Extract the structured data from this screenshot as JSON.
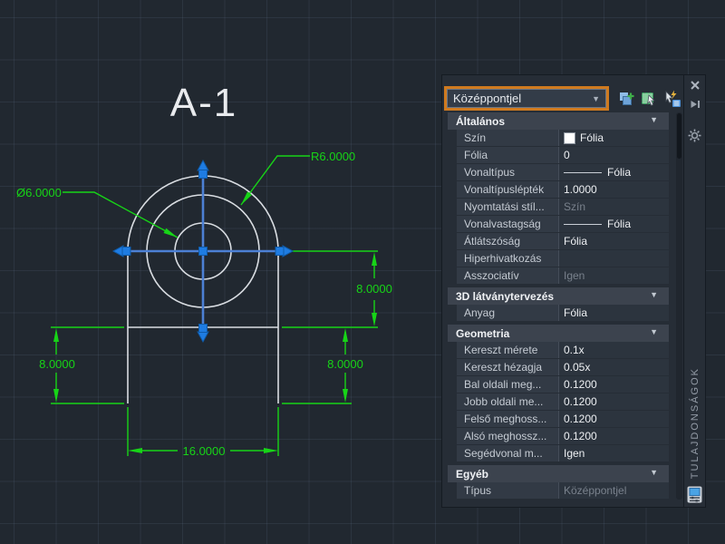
{
  "drawing": {
    "view_label": "A-1",
    "dims": {
      "radius": "R6.0000",
      "diameter": "Ø6.0000",
      "vert_right_top": "8.0000",
      "vert_right_bottom": "8.0000",
      "vert_left": "8.0000",
      "horiz_bottom": "16.0000"
    },
    "colors": {
      "canvas_background": "#212830",
      "dimension_green": "#17d417",
      "geometry_white": "#d9dde2",
      "selection_blue": "#4c80d4",
      "grip_blue": "#1e7ce2"
    }
  },
  "palette": {
    "title": "TULAJDONSÁGOK",
    "selector": {
      "value": "Középpontjel"
    },
    "accent_border": "#cf7a1f",
    "toolbar_icons": [
      "toggle-pickadd",
      "select-objects",
      "quick-select"
    ],
    "titlebar_icons": [
      "close",
      "auto-hide",
      "settings",
      "palette-properties"
    ],
    "sections": [
      {
        "title": "Általános",
        "rows": [
          {
            "label": "Szín",
            "value": "Fólia"
          },
          {
            "label": "Fólia",
            "value": "0"
          },
          {
            "label": "Vonaltípus",
            "value": "Fólia"
          },
          {
            "label": "Vonaltípuslépték",
            "value": "1.0000"
          },
          {
            "label": "Nyomtatási stíl...",
            "value": "Szín"
          },
          {
            "label": "Vonalvastagság",
            "value": "Fólia"
          },
          {
            "label": "Átlátszóság",
            "value": "Fólia"
          },
          {
            "label": "Hiperhivatkozás",
            "value": ""
          },
          {
            "label": "Asszociatív",
            "value": "Igen"
          }
        ]
      },
      {
        "title": "3D látványtervezés",
        "rows": [
          {
            "label": "Anyag",
            "value": "Fólia"
          }
        ]
      },
      {
        "title": "Geometria",
        "rows": [
          {
            "label": "Kereszt mérete",
            "value": "0.1x"
          },
          {
            "label": "Kereszt hézagja",
            "value": "0.05x"
          },
          {
            "label": "Bal oldali meg...",
            "value": "0.1200"
          },
          {
            "label": "Jobb oldali me...",
            "value": "0.1200"
          },
          {
            "label": "Felső meghoss...",
            "value": "0.1200"
          },
          {
            "label": "Alsó meghossz...",
            "value": "0.1200"
          },
          {
            "label": "Segédvonal m...",
            "value": "Igen"
          }
        ]
      },
      {
        "title": "Egyéb",
        "rows": [
          {
            "label": "Típus",
            "value": "Középpontjel"
          }
        ]
      }
    ]
  }
}
